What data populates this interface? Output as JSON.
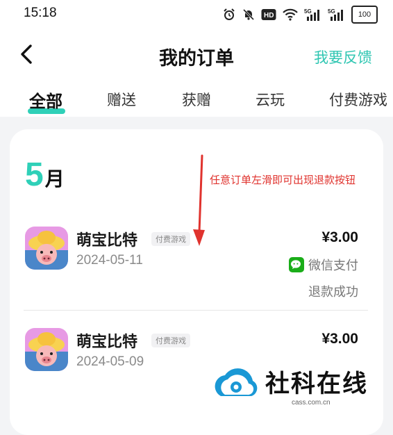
{
  "status_bar": {
    "time": "15:18",
    "icons": [
      "alarm-icon",
      "mute-icon",
      "hd-icon",
      "wifi-icon",
      "5g-signal-icon",
      "5g-signal-icon"
    ],
    "hd_label": "HD",
    "battery": "100"
  },
  "header": {
    "title": "我的订单",
    "feedback_label": "我要反馈",
    "back_icon": "chevron-left-icon"
  },
  "tabs": [
    {
      "label": "全部",
      "active": true
    },
    {
      "label": "赠送",
      "active": false
    },
    {
      "label": "获赠",
      "active": false
    },
    {
      "label": "云玩",
      "active": false
    },
    {
      "label": "付费游戏",
      "active": false
    }
  ],
  "orders_section": {
    "month_num": "5",
    "month_unit": "月",
    "annotation": "任意订单左滑即可出现退款按钮",
    "orders": [
      {
        "name": "萌宝比特",
        "tag": "付费游戏",
        "date": "2024-05-11",
        "price": "¥3.00",
        "payment": "微信支付",
        "status": "退款成功"
      },
      {
        "name": "萌宝比特",
        "tag": "付费游戏",
        "date": "2024-05-09",
        "price": "¥3.00"
      }
    ]
  },
  "watermark": {
    "text": "社科在线",
    "domain": "cass.com.cn"
  },
  "colors": {
    "accent": "#2fd0b8",
    "annotation": "#e0332e",
    "wechat": "#1aad19"
  }
}
